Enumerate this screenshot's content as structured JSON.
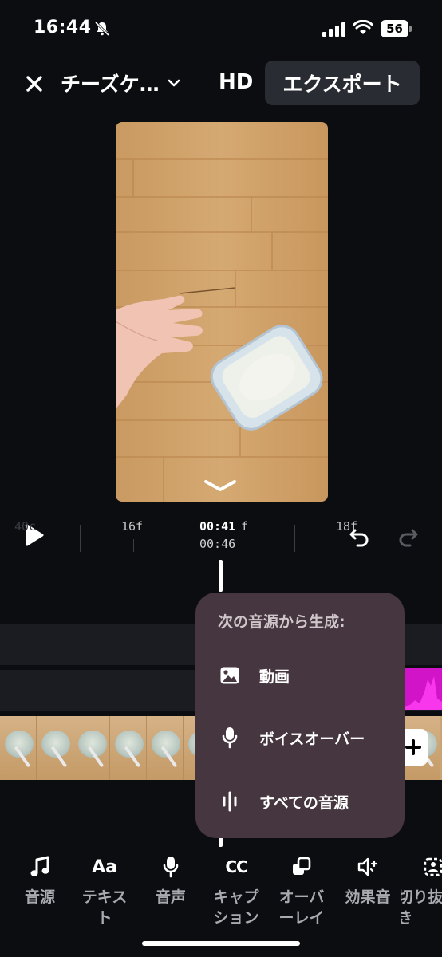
{
  "status_bar": {
    "time": "16:44",
    "battery": "56"
  },
  "header": {
    "project_title": "チーズケ…",
    "quality": "HD",
    "export_label": "エクスポート"
  },
  "timeline": {
    "tick_labels": [
      "40c",
      "16f",
      "f",
      "18f"
    ],
    "current_time": "00:41",
    "total_time": "00:46"
  },
  "popup": {
    "title": "次の音源から生成:",
    "items": [
      {
        "label": "動画",
        "icon": "image-icon"
      },
      {
        "label": "ボイスオーバー",
        "icon": "microphone-icon"
      },
      {
        "label": "すべての音源",
        "icon": "waveform-icon"
      }
    ]
  },
  "toolbar": {
    "items": [
      {
        "label": "音源",
        "icon": "music-note-icon"
      },
      {
        "label": "テキスト",
        "icon": "text-aa-icon"
      },
      {
        "label": "音声",
        "icon": "microphone-icon"
      },
      {
        "label": "キャプション",
        "icon": "captions-cc-icon"
      },
      {
        "label": "オーバーレイ",
        "icon": "overlay-icon"
      },
      {
        "label": "効果音",
        "icon": "sound-effect-icon"
      },
      {
        "label": "切り抜き",
        "icon": "cutout-icon"
      }
    ]
  },
  "colors": {
    "background": "#0c0d11",
    "popup": "#46363f",
    "audio_clip": "#d214c9",
    "export_button": "#2a2c33"
  }
}
